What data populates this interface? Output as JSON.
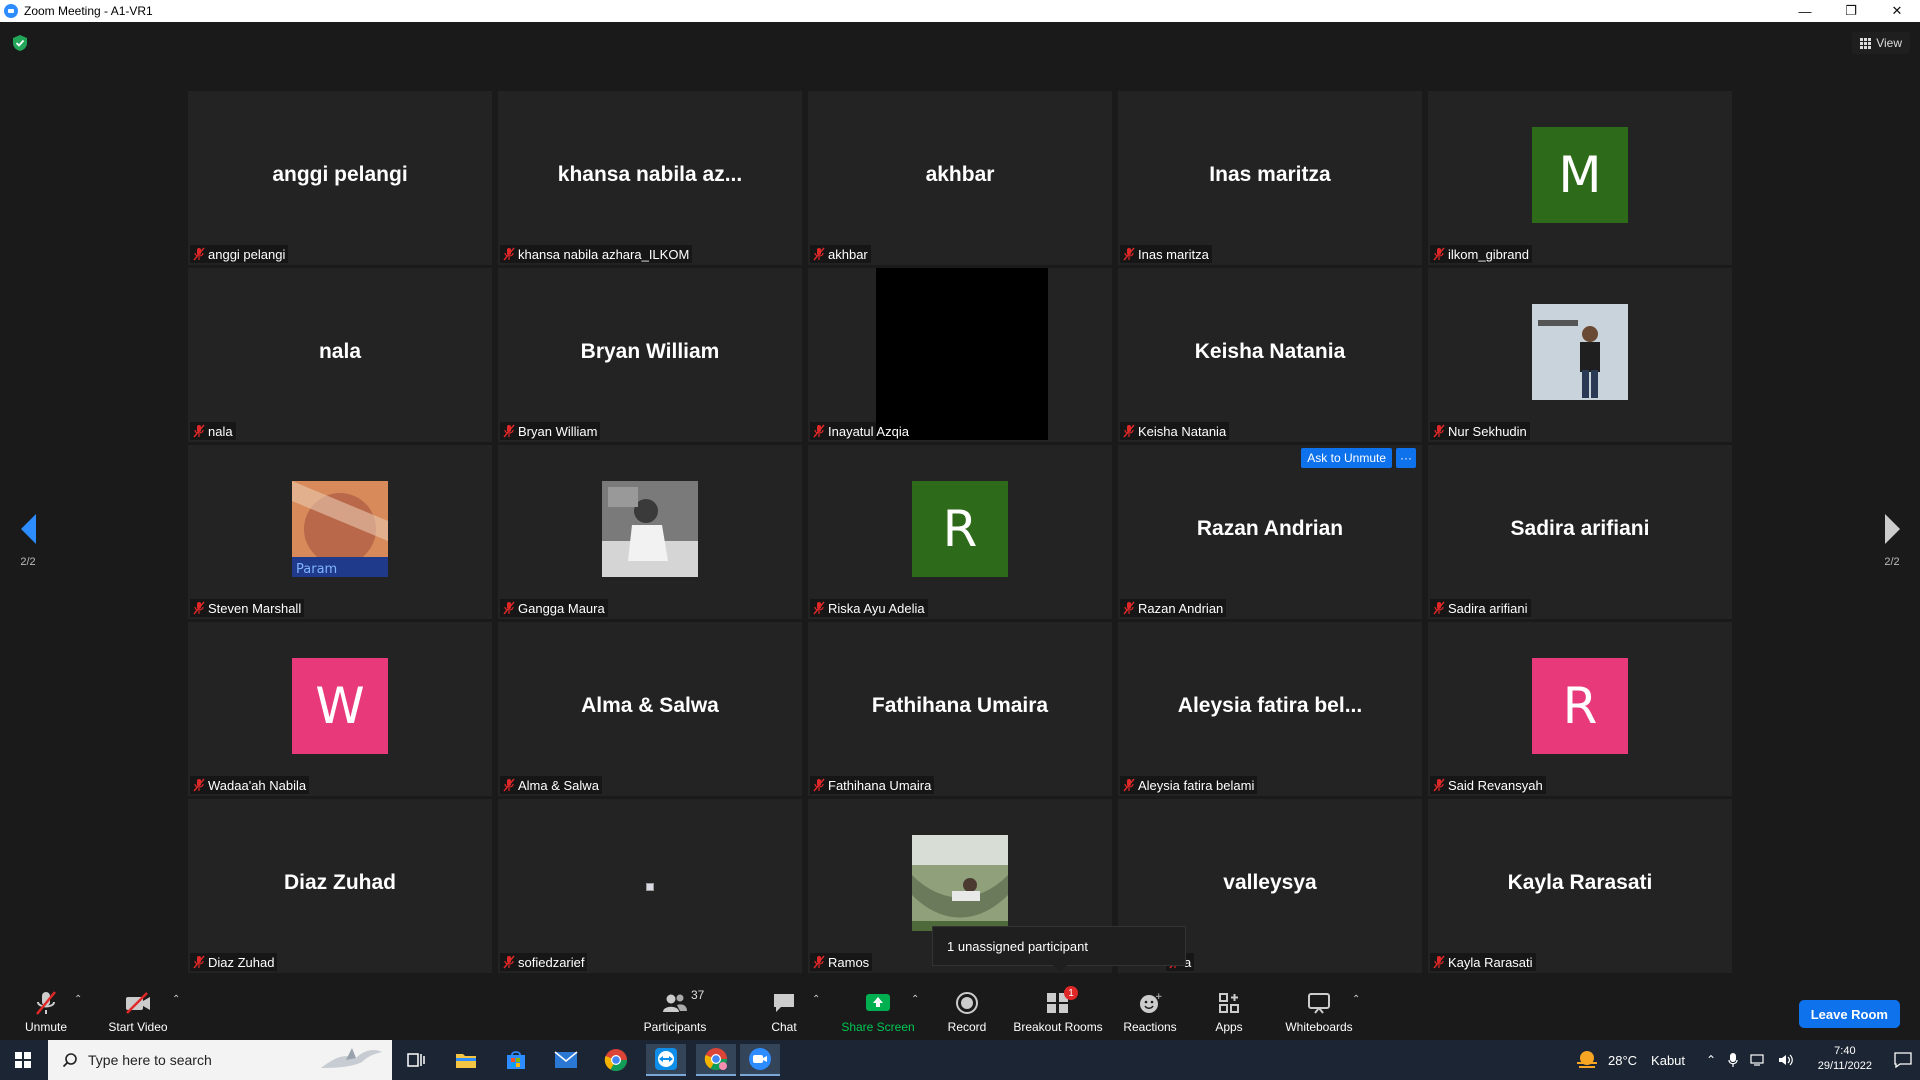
{
  "window": {
    "title": "Zoom Meeting - A1-VR1",
    "controls": [
      "minimize",
      "restore",
      "close"
    ]
  },
  "meeting": {
    "view_label": "View",
    "page_indicator_left": "2/2",
    "page_indicator_right": "2/2",
    "ask_to_unmute_label": "Ask to Unmute",
    "more_label": "···",
    "unassigned_tooltip": "1 unassigned participant"
  },
  "tiles": [
    {
      "name": "anggi pelangi",
      "display": "anggi pelangi",
      "kind": "name"
    },
    {
      "name": "khansa nabila azhara_ILKOM",
      "display": "khansa nabila az...",
      "kind": "name"
    },
    {
      "name": "akhbar",
      "display": "akhbar",
      "kind": "name"
    },
    {
      "name": "Inas maritza",
      "display": "Inas maritza",
      "kind": "name"
    },
    {
      "name": "ilkom_gibrand",
      "display": "M",
      "kind": "avatar",
      "color": "#2d6a1a"
    },
    {
      "name": "nala",
      "display": "nala",
      "kind": "name"
    },
    {
      "name": "Bryan William",
      "display": "Bryan William",
      "kind": "name"
    },
    {
      "name": "Inayatul Azqia",
      "display": "",
      "kind": "video-black"
    },
    {
      "name": "Keisha Natania",
      "display": "Keisha Natania",
      "kind": "name"
    },
    {
      "name": "Nur Sekhudin",
      "display": "",
      "kind": "photo-man"
    },
    {
      "name": "Steven Marshall",
      "display": "",
      "kind": "photo-face"
    },
    {
      "name": "Gangga Maura",
      "display": "",
      "kind": "photo-girl"
    },
    {
      "name": "Riska Ayu Adelia",
      "display": "R",
      "kind": "avatar",
      "color": "#2d6a1a"
    },
    {
      "name": "Razan Andrian",
      "display": "Razan Andrian",
      "kind": "name",
      "hover": true
    },
    {
      "name": "Sadira arifiani",
      "display": "Sadira arifiani",
      "kind": "name"
    },
    {
      "name": "Wadaa'ah Nabila",
      "display": "W",
      "kind": "avatar",
      "color": "#e8397a"
    },
    {
      "name": "Alma & Salwa",
      "display": "Alma & Salwa",
      "kind": "name"
    },
    {
      "name": "Fathihana Umaira",
      "display": "Fathihana Umaira",
      "kind": "name"
    },
    {
      "name": "Aleysia fatira belami",
      "display": "Aleysia fatira bel...",
      "kind": "name"
    },
    {
      "name": "Said Revansyah",
      "display": "R",
      "kind": "avatar",
      "color": "#e8397a"
    },
    {
      "name": "Diaz Zuhad",
      "display": "Diaz Zuhad",
      "kind": "name"
    },
    {
      "name": "sofiedzarief",
      "display": "",
      "kind": "tiny"
    },
    {
      "name": "Ramos",
      "display": "",
      "kind": "photo-hammock"
    },
    {
      "name": "valleysya",
      "display": "valleysya",
      "kind": "name",
      "label_partial": "a"
    },
    {
      "name": "Kayla Rarasati",
      "display": "Kayla Rarasati",
      "kind": "name"
    }
  ],
  "toolbar": {
    "unmute": "Unmute",
    "start_video": "Start Video",
    "participants": "Participants",
    "participants_count": "37",
    "chat": "Chat",
    "share_screen": "Share Screen",
    "record": "Record",
    "breakout_rooms": "Breakout Rooms",
    "breakout_badge": "1",
    "reactions": "Reactions",
    "apps": "Apps",
    "whiteboards": "Whiteboards",
    "leave_room": "Leave Room"
  },
  "taskbar": {
    "search_placeholder": "Type here to search",
    "weather_temp": "28°C",
    "weather_desc": "Kabut",
    "time": "7:40",
    "date": "29/11/2022",
    "apps": [
      "task-view",
      "file-explorer",
      "microsoft-store",
      "mail",
      "chrome",
      "teamviewer",
      "chrome-profile",
      "zoom"
    ]
  },
  "colors": {
    "accent": "#0e72ed",
    "share_green": "#00b050",
    "muted_red": "#e02828",
    "tile_bg": "#232323"
  }
}
